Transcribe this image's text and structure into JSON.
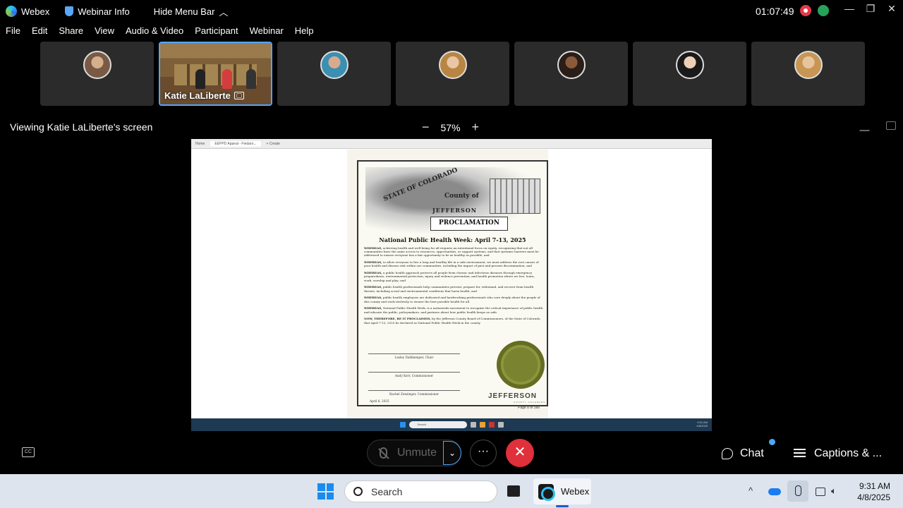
{
  "titlebar": {
    "app_name": "Webex",
    "webinar_info": "Webinar Info",
    "hide_menu": "Hide Menu Bar",
    "caret": "︿",
    "timer": "01:07:49",
    "minimize": "—",
    "restore": "❐",
    "close": "✕"
  },
  "menu": [
    "File",
    "Edit",
    "Share",
    "View",
    "Audio & Video",
    "Participant",
    "Webinar",
    "Help"
  ],
  "participants": {
    "active_name": "Katie LaLiberte",
    "share_glyph": "▢"
  },
  "share_bar": {
    "viewing": "Viewing Katie LaLiberte's screen",
    "zoom_out": "−",
    "zoom": "57%",
    "zoom_in": "+"
  },
  "shared": {
    "tab_home": "Home",
    "tab_doc": "EEPPD Appeal - Fiedaro...",
    "tab_new": "+ Create",
    "page_indicator": "Page 8 of 386",
    "taskbar_search": "Search",
    "taskbar_time": "9:31 AM",
    "taskbar_date": "4/8/2025"
  },
  "proclamation": {
    "state": "STATE OF COLORADO",
    "county": "County of",
    "jefferson": "JEFFERSON",
    "banner": "PROCLAMATION",
    "title": "National Public Health Week: April 7-13, 2025",
    "clauses": [
      {
        "lead": "WHEREAS,",
        "text": "achieving health and well-being for all requires an intentional focus on equity, recognizing that not all communities have the same access to resources, opportunities, or support systems, and that systemic barriers must be addressed to ensure everyone has a fair opportunity to be as healthy as possible; and"
      },
      {
        "lead": "WHEREAS,",
        "text": "to allow everyone to live a long and healthy life in a safe environment, we must address the root causes of poor health and disease risk within our communities, including the impact of past and present discrimination; and"
      },
      {
        "lead": "WHEREAS,",
        "text": "a public health approach protects all people from chronic and infectious diseases through emergency preparedness, environmental protection, injury and violence prevention, and health promotion where we live, learn, work, worship and play; and"
      },
      {
        "lead": "WHEREAS,",
        "text": "public health professionals help communities prevent, prepare for, withstand, and recover from health threats, including social and environmental conditions that harm health; and"
      },
      {
        "lead": "WHEREAS,",
        "text": "public health employees are dedicated and hardworking professionals who care deeply about the people of this county and work tirelessly to ensure the best possible health for all."
      },
      {
        "lead": "WHEREAS,",
        "text": "National Public Health Week, is a nationwide movement to recognize the critical importance of public health and educate the public, policymakers, and partners about how public health keeps us safe."
      },
      {
        "lead": "NOW, THEREFORE, BE IT PROCLAIMED,",
        "text": "by the Jefferson County Board of Commissioners, of the State of Colorado, that April 7-13, 2025 be declared as National Public Health Week in the county."
      }
    ],
    "signatures": [
      "Lesley Dahlkemper, Chair",
      "Andy Kerr, Commissioner",
      "Rachel Zenzinger, Commissioner"
    ],
    "date": "April 8, 2025",
    "logo": "JEFFERSON",
    "logo_sub": "COUNTY COLORADO"
  },
  "controls": {
    "cc": "CC",
    "unmute": "Unmute",
    "caret": "⌄",
    "more": "···",
    "end": "✕",
    "chat": "Chat",
    "captions": "Captions & ..."
  },
  "taskbar": {
    "search": "Search",
    "webex": "Webex",
    "up_arrow": "^",
    "speaker": "🔈︎",
    "time": "9:31 AM",
    "date": "4/8/2025"
  }
}
